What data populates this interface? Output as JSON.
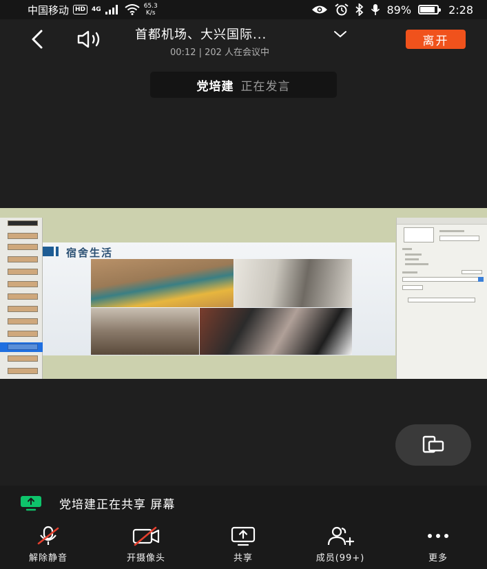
{
  "status_bar": {
    "carrier": "中国移动",
    "hd": "HD",
    "network": "4G",
    "speed_value": "65.3",
    "speed_unit": "K/s",
    "battery": "89%",
    "time": "2:28"
  },
  "header": {
    "title": "首都机场、大兴国际...",
    "subtitle": "00:12 | 202 人在会议中",
    "leave_label": "离开"
  },
  "speaking": {
    "name": "党培建",
    "status": "正在发言"
  },
  "slide": {
    "title": "宿舍生活"
  },
  "sharing_notice": "党培建正在共享 屏幕",
  "toolbar": {
    "unmute": "解除静音",
    "camera": "开摄像头",
    "share": "共享",
    "members": "成员(99+)",
    "more": "更多"
  },
  "colors": {
    "leave": "#f0521c",
    "share_icon": "#0ec46b",
    "mute_slash": "#e5402e"
  }
}
